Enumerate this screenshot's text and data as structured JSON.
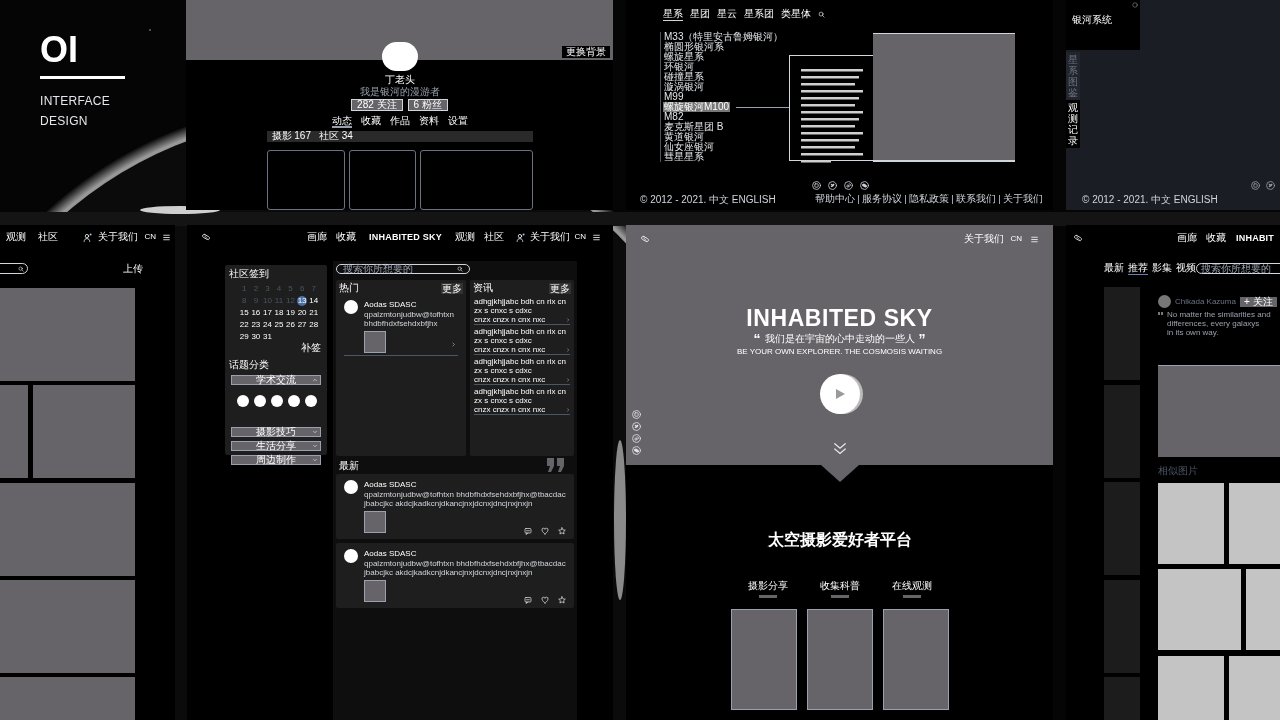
{
  "title_card": {
    "number": "OI",
    "lines": [
      "INTERFACE",
      "DESIGN"
    ]
  },
  "profile_page": {
    "cover_button": "更换背景",
    "name": "丁老头",
    "bio": "我是银河的漫游者",
    "stats": [
      "282 关注",
      "6 粉丝"
    ],
    "tabs": [
      {
        "label": "动态",
        "selected": true
      },
      {
        "label": "收藏",
        "selected": false
      },
      {
        "label": "作品",
        "selected": false
      },
      {
        "label": "资料",
        "selected": false
      },
      {
        "label": "设置",
        "selected": false
      }
    ],
    "counts": [
      "摄影 167",
      "社区 34"
    ]
  },
  "galaxy_page": {
    "tabs": [
      {
        "label": "星系",
        "selected": true
      },
      {
        "label": "星团",
        "selected": false
      },
      {
        "label": "星云",
        "selected": false
      },
      {
        "label": "星系团",
        "selected": false
      },
      {
        "label": "类星体",
        "selected": false
      }
    ],
    "list": [
      {
        "label": "M33（特里安古鲁姆银河）",
        "selected": false
      },
      {
        "label": "椭圆形银河系",
        "selected": false
      },
      {
        "label": "螺旋星系",
        "selected": false
      },
      {
        "label": "环银河",
        "selected": false
      },
      {
        "label": "碰撞星系",
        "selected": false
      },
      {
        "label": "漩涡银河",
        "selected": false
      },
      {
        "label": "M99",
        "selected": false
      },
      {
        "label": "螺旋银河M100",
        "selected": true
      },
      {
        "label": "M82",
        "selected": false
      },
      {
        "label": "麦克斯星团 B",
        "selected": false
      },
      {
        "label": "黄道银河",
        "selected": false
      },
      {
        "label": "仙女座银河",
        "selected": false
      },
      {
        "label": "彗星星系",
        "selected": false
      }
    ],
    "footer": "© 2012 - 2021. 中文 ENGLISH",
    "footer_links": [
      "帮助中心",
      "服务协议",
      "隐私政策",
      "联系我们",
      "关于我们"
    ]
  },
  "dark_page": {
    "card_label": "银河系统",
    "side_tabs": [
      {
        "label": "星系图鉴",
        "selected": false
      },
      {
        "label": "观测记录",
        "selected": true
      }
    ],
    "footer": "© 2012 - 2021. 中文 ENGLISH"
  },
  "upload_page": {
    "nav": [
      "观测",
      "社区"
    ],
    "about": "关于我们",
    "lang": "CN",
    "upload": "上传"
  },
  "community_page": {
    "nav_left": [
      "画廊",
      "收藏"
    ],
    "logo": "INHABITED SKY",
    "nav_right": [
      "观测",
      "社区"
    ],
    "about": "关于我们",
    "lang": "CN",
    "checkin_title": "社区签到",
    "days": [
      {
        "day": "1",
        "past": true,
        "selected": false
      },
      {
        "day": "2",
        "past": true,
        "selected": false
      },
      {
        "day": "3",
        "past": true,
        "selected": false
      },
      {
        "day": "4",
        "past": true,
        "selected": false
      },
      {
        "day": "5",
        "past": true,
        "selected": false
      },
      {
        "day": "6",
        "past": true,
        "selected": false
      },
      {
        "day": "7",
        "past": true,
        "selected": false
      },
      {
        "day": "8",
        "past": true,
        "selected": false
      },
      {
        "day": "9",
        "past": true,
        "selected": false
      },
      {
        "day": "10",
        "past": true,
        "selected": false
      },
      {
        "day": "11",
        "past": true,
        "selected": false
      },
      {
        "day": "12",
        "past": true,
        "selected": false
      },
      {
        "day": "13",
        "past": false,
        "selected": true
      },
      {
        "day": "14",
        "past": false,
        "selected": false
      },
      {
        "day": "15",
        "past": false,
        "selected": false
      },
      {
        "day": "16",
        "past": false,
        "selected": false
      },
      {
        "day": "17",
        "past": false,
        "selected": false
      },
      {
        "day": "18",
        "past": false,
        "selected": false
      },
      {
        "day": "19",
        "past": false,
        "selected": false
      },
      {
        "day": "20",
        "past": false,
        "selected": false
      },
      {
        "day": "21",
        "past": false,
        "selected": false
      },
      {
        "day": "22",
        "past": false,
        "selected": false
      },
      {
        "day": "23",
        "past": false,
        "selected": false
      },
      {
        "day": "24",
        "past": false,
        "selected": false
      },
      {
        "day": "25",
        "past": false,
        "selected": false
      },
      {
        "day": "26",
        "past": false,
        "selected": false
      },
      {
        "day": "27",
        "past": false,
        "selected": false
      },
      {
        "day": "28",
        "past": false,
        "selected": false
      },
      {
        "day": "29",
        "past": false,
        "selected": false
      },
      {
        "day": "30",
        "past": false,
        "selected": false
      },
      {
        "day": "31",
        "past": false,
        "selected": false
      }
    ],
    "makeup_button": "补签",
    "topics_title": "话题分类",
    "topics": [
      {
        "label": "学术交流",
        "expanded": true
      },
      {
        "label": "摄影技巧",
        "expanded": false
      },
      {
        "label": "生活分享",
        "expanded": false
      },
      {
        "label": "周边制作",
        "expanded": false
      }
    ],
    "search": {
      "placeholder": "搜索你所想要的"
    },
    "hot": {
      "title": "热门",
      "more": "更多",
      "post": {
        "author": "Aodas SDASC",
        "text": "qpalzmtonjudbw@tofhtxn bhdbfhdxfsehdxbfjhx"
      }
    },
    "news": {
      "title": "资讯",
      "more": "更多",
      "items": [
        {
          "line1": "adhgjkhjjabc bdh cn rix cnzx s cnxc s cdxc",
          "line2": "cnzx cnzx n cnx nxc"
        },
        {
          "line1": "adhgjkhjjabc bdh cn rix cnzx s cnxc s cdxc",
          "line2": "cnzx cnzx n cnx nxc"
        },
        {
          "line1": "adhgjkhjjabc bdh cn rix cnzx s cnxc s cdxc",
          "line2": "cnzx cnzx n cnx nxc"
        },
        {
          "line1": "adhgjkhjjabc bdh cn rix cnzx s cnxc s cdxc",
          "line2": "cnzx cnzx n cnx nxc"
        }
      ]
    },
    "latest_title": "最新",
    "latest": [
      {
        "author": "Aodas SDASC",
        "text": "qpalzmtonjudbw@tofhtxn bhdbfhdxfsehdxbfjhx@tbacdacjbabcjkc akdcjkadkcnjdkancjnxjdcnxjdncjnxjnxjn"
      },
      {
        "author": "Aodas SDASC",
        "text": "qpalzmtonjudbw@tofhtxn bhdbfhdxfsehdxbfjhx@tbacdacjbabcjkc akdcjkadkcnjdkancjnxjdcnxjdncjnxjnxjn"
      }
    ]
  },
  "hero_page": {
    "about": "关于我们",
    "lang": "CN",
    "title": "INHABITED SKY",
    "quote_open": "“",
    "quote": "我们是在宇宙的心中走动的一些人",
    "quote_close": "”",
    "subtitle": "BE YOUR OWN EXPLORER. THE COSMOSIS WAITING",
    "section_title": "太空摄影爱好者平台",
    "categories": [
      "摄影分享",
      "收集科普",
      "在线观测"
    ]
  },
  "recommend_page": {
    "nav": [
      "画廊",
      "收藏"
    ],
    "logo": "INHABIT",
    "tabs": [
      {
        "label": "最新",
        "selected": false
      },
      {
        "label": "推荐",
        "selected": true
      },
      {
        "label": "影集",
        "selected": false
      },
      {
        "label": "视频",
        "selected": false
      }
    ],
    "search": {
      "placeholder": "搜索你所想要的"
    },
    "user": "Chikada Kazuma",
    "follow": "+ 关注",
    "quote": [
      "No matter the similarities and differences, every galaxys",
      "in its own way."
    ],
    "similar_title": "相似图片"
  }
}
